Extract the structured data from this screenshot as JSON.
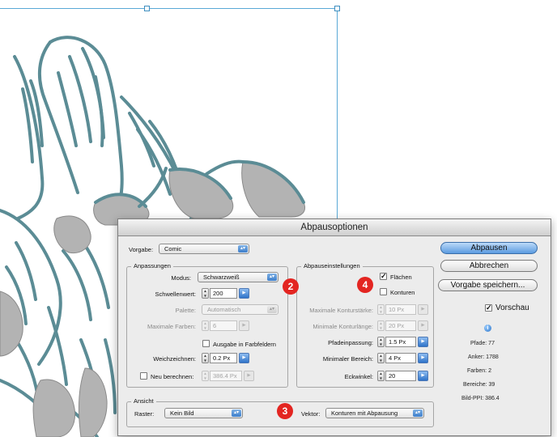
{
  "dialog": {
    "title": "Abpausoptionen",
    "vorgabe": {
      "label": "Vorgabe:",
      "value": "Comic"
    },
    "anpassungen": {
      "title": "Anpassungen",
      "modus": {
        "label": "Modus:",
        "value": "Schwarzweiß"
      },
      "schwellenwert": {
        "label": "Schwellenwert:",
        "value": "200"
      },
      "palette": {
        "label": "Palette:",
        "value": "Automatisch"
      },
      "max_farben": {
        "label": "Maximale Farben:",
        "value": "6"
      },
      "ausgabe": {
        "label": "Ausgabe in Farbfeldern",
        "checked": false
      },
      "weichzeichnen": {
        "label": "Weichzeichnen:",
        "value": "0.2 Px"
      },
      "neu_berechnen": {
        "label": "Neu berechnen:",
        "value": "386.4 Px",
        "checked": false
      }
    },
    "abpauseinstellungen": {
      "title": "Abpauseinstellungen",
      "flaechen": {
        "label": "Flächen",
        "checked": true
      },
      "konturen": {
        "label": "Konturen",
        "checked": false
      },
      "max_konturstaerke": {
        "label": "Maximale Konturstärke:",
        "value": "10 Px"
      },
      "min_konturlaenge": {
        "label": "Minimale Konturlänge:",
        "value": "20 Px"
      },
      "pfadeinpassung": {
        "label": "Pfadeinpassung:",
        "value": "1.5 Px"
      },
      "min_bereich": {
        "label": "Minimaler Bereich:",
        "value": "4 Px"
      },
      "eckwinkel": {
        "label": "Eckwinkel:",
        "value": "20"
      }
    },
    "ansicht": {
      "title": "Ansicht",
      "raster": {
        "label": "Raster:",
        "value": "Kein Bild"
      },
      "vektor": {
        "label": "Vektor:",
        "value": "Konturen mit Abpausung"
      }
    },
    "buttons": {
      "abpausen": "Abpausen",
      "abbrechen": "Abbrechen",
      "vorgabe_speichern": "Vorgabe speichern..."
    },
    "vorschau": {
      "label": "Vorschau",
      "checked": true
    },
    "stats": {
      "pfade": "Pfade: 77",
      "anker": "Anker: 1788",
      "farben": "Farben: 2",
      "bereiche": "Bereiche: 39",
      "bild_ppi": "Bild-PPI: 386.4"
    }
  },
  "callouts": [
    "2",
    "3",
    "4"
  ],
  "colors": {
    "banana_stroke": "#5b8c95",
    "banana_fill": "#b3b3b3",
    "selection": "#5aa9d6",
    "callout": "#e32521",
    "default_button": "#5b9be0"
  }
}
